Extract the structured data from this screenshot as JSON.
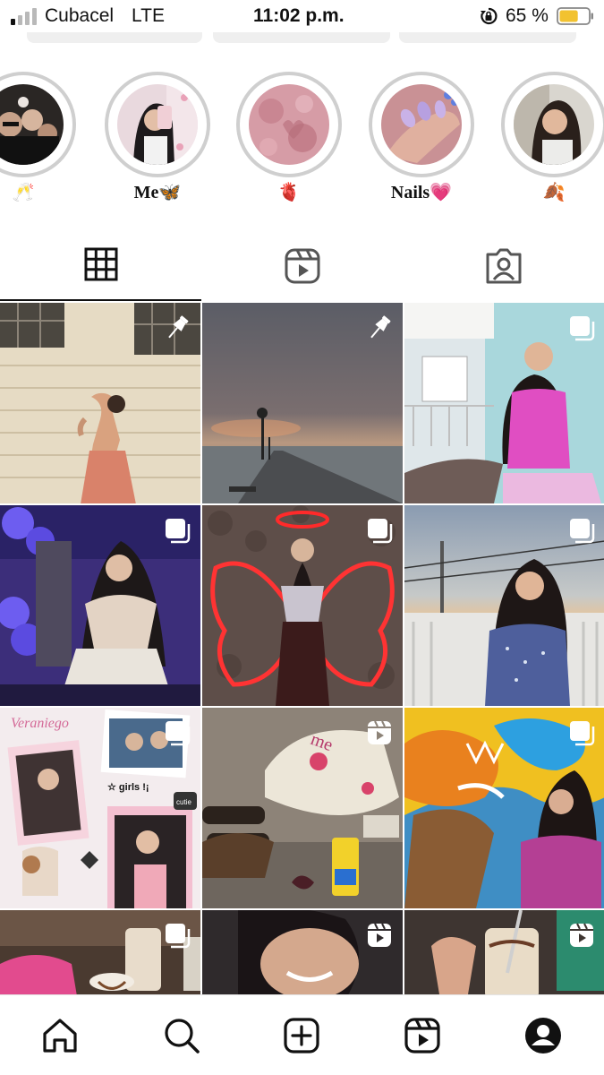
{
  "status_bar": {
    "carrier": "Cubacel",
    "network": "LTE",
    "time": "11:02 p.m.",
    "battery_percent": "65 %",
    "battery_level": 0.65,
    "battery_color": "#f2c230"
  },
  "highlights": [
    {
      "label": "🥂",
      "theme": "party"
    },
    {
      "label": "Me🦋",
      "theme": "selfie"
    },
    {
      "label": "🫀",
      "theme": "pink-texture"
    },
    {
      "label": "Nails💗",
      "theme": "nails"
    },
    {
      "label": "🍂",
      "theme": "portrait"
    }
  ],
  "profile_tabs": [
    {
      "name": "posts-grid",
      "icon": "grid-icon",
      "selected": true
    },
    {
      "name": "reels",
      "icon": "reels-icon",
      "selected": false
    },
    {
      "name": "tagged",
      "icon": "tagged-person-icon",
      "selected": false
    }
  ],
  "posts": [
    {
      "theme": "night-wall",
      "badge": "pin-icon"
    },
    {
      "theme": "pier-sunset",
      "badge": "pin-icon"
    },
    {
      "theme": "balcony-pink",
      "badge": "carousel-icon"
    },
    {
      "theme": "purple-balloons",
      "badge": "carousel-icon"
    },
    {
      "theme": "neon-wings",
      "badge": "carousel-icon"
    },
    {
      "theme": "rooftop-blue",
      "badge": "carousel-icon"
    },
    {
      "theme": "collage",
      "badge": "carousel-icon"
    },
    {
      "theme": "beach-items",
      "badge": "reel-icon"
    },
    {
      "theme": "dragon-mural",
      "badge": "carousel-icon"
    },
    {
      "theme": "coffee-bag",
      "badge": "carousel-icon"
    },
    {
      "theme": "smile-closeup",
      "badge": "reel-icon"
    },
    {
      "theme": "drink-hand",
      "badge": "reel-icon"
    }
  ],
  "collage_texts": [
    "Veraniego",
    "☆ girls !¡",
    "cutie"
  ],
  "bottom_nav": [
    {
      "name": "home",
      "icon": "home-icon"
    },
    {
      "name": "search",
      "icon": "search-icon"
    },
    {
      "name": "create",
      "icon": "add-post-icon"
    },
    {
      "name": "reels",
      "icon": "reels-icon"
    },
    {
      "name": "profile",
      "icon": "profile-icon",
      "selected": true
    }
  ]
}
